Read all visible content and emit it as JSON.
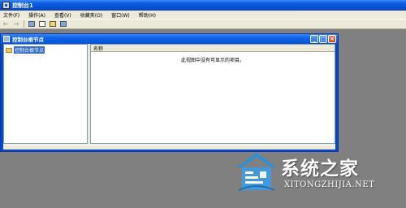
{
  "window": {
    "title": "控制台1"
  },
  "menu": {
    "items": [
      "文件(F)",
      "操作(A)",
      "查看(V)",
      "收藏夹(O)",
      "窗口(W)",
      "帮助(H)"
    ]
  },
  "toolbar": {
    "back_glyph": "←",
    "forward_glyph": "→"
  },
  "child_window": {
    "title": "控制台根节点",
    "buttons": {
      "minimize": "_",
      "maximize": "□",
      "close": "×"
    }
  },
  "tree": {
    "root_label": "控制台根节点"
  },
  "list": {
    "column_name": "名称",
    "empty_message": "此视图中没有可显示的项目。"
  },
  "watermark": {
    "title": "系统之家",
    "url": "XITONGZHIJIA.NET"
  },
  "colors": {
    "title_blue": "#0a5fe0",
    "face": "#ece9d8",
    "desktop_gray": "#808080",
    "selection": "#316ac5"
  }
}
